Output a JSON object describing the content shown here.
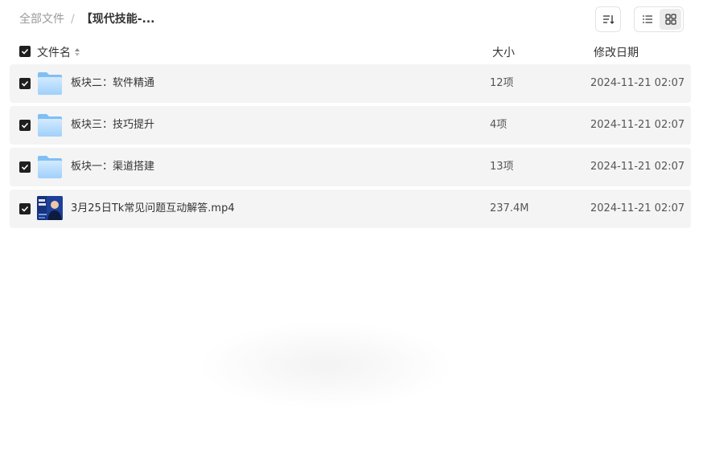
{
  "breadcrumb": {
    "root": "全部文件",
    "separator": "/",
    "current": "【现代技能-..."
  },
  "header": {
    "name_label": "文件名",
    "size_label": "大小",
    "date_label": "修改日期"
  },
  "icons": {
    "sort": "sort-lines-icon",
    "list_view": "list-view-icon",
    "grid_view": "grid-view-icon",
    "folder": "folder-icon",
    "video": "video-thumbnail"
  },
  "colors": {
    "row_bg": "#f4f4f4",
    "checkbox": "#1f1f1f",
    "folder_light": "#bfe0ff",
    "folder_dark": "#7ec0f5"
  },
  "files": [
    {
      "type": "folder",
      "name": "板块二：软件精通",
      "size": "12项",
      "date": "2024-11-21 02:07"
    },
    {
      "type": "folder",
      "name": "板块三：技巧提升",
      "size": "4项",
      "date": "2024-11-21 02:07"
    },
    {
      "type": "folder",
      "name": "板块一：渠道搭建",
      "size": "13项",
      "date": "2024-11-21 02:07"
    },
    {
      "type": "video",
      "name": "3月25日Tk常见问题互动解答.mp4",
      "size": "237.4M",
      "date": "2024-11-21 02:07"
    }
  ]
}
